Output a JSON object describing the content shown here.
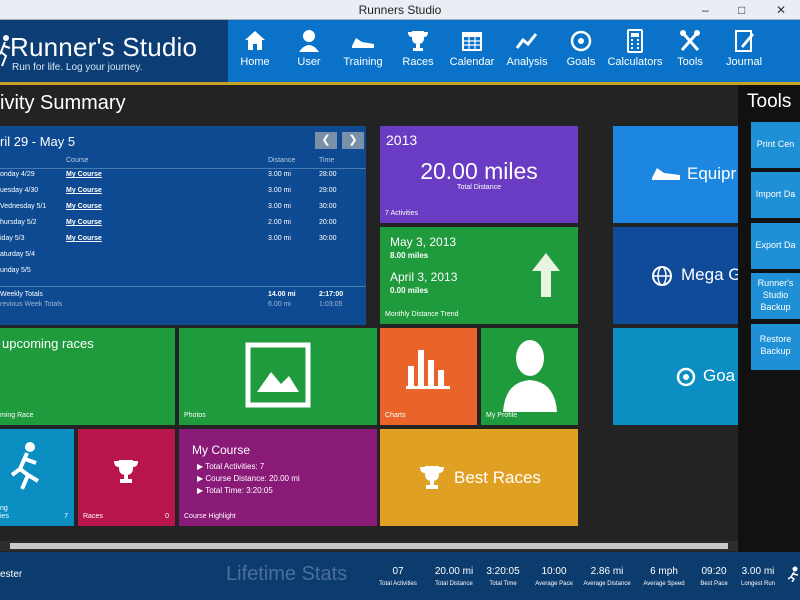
{
  "window": {
    "title": "Runners Studio"
  },
  "brand": {
    "title": "Runner's Studio",
    "tagline": "Run for life. Log your journey."
  },
  "nav": [
    "Home",
    "User",
    "Training",
    "Races",
    "Calendar",
    "Analysis",
    "Goals",
    "Calculators",
    "Tools",
    "Journal"
  ],
  "page": {
    "title": "ivity Summary"
  },
  "week": {
    "range": "ril 29 - May 5",
    "headers": {
      "course": "Course",
      "distance": "Distance",
      "time": "Time"
    },
    "rows": [
      {
        "day": "onday 4/29",
        "course": "My Course",
        "distance": "3.00 mi",
        "time": "28:00"
      },
      {
        "day": "uesday 4/30",
        "course": "My Course",
        "distance": "3.00 mi",
        "time": "29:00"
      },
      {
        "day": "Vednesday 5/1",
        "course": "My Course",
        "distance": "3.00 mi",
        "time": "30:00"
      },
      {
        "day": "hursday 5/2",
        "course": "My Course",
        "distance": "2.00 mi",
        "time": "20:00"
      },
      {
        "day": "iday 5/3",
        "course": "My Course",
        "distance": "3.00 mi",
        "time": "30:00"
      },
      {
        "day": "aturday 5/4",
        "course": "",
        "distance": "",
        "time": ""
      },
      {
        "day": "unday 5/5",
        "course": "",
        "distance": "",
        "time": ""
      }
    ],
    "totals": {
      "label": "Weekly Totals",
      "distance": "14.00 mi",
      "time": "2:17:00"
    },
    "previous": {
      "label": "revious Week Totals",
      "distance": "6.00 mi",
      "time": "1:03:05"
    }
  },
  "year": {
    "label": "2013",
    "distance": "20.00 miles",
    "caption": "Total Distance",
    "activities": "7 Activities"
  },
  "trend": {
    "d1": "May 3, 2013",
    "m1": "8.00 miles",
    "d2": "April 3, 2013",
    "m2": "0.00 miles",
    "label": "Monthly Distance Trend"
  },
  "tiles": {
    "equip": "Equipr",
    "mega": "Mega G",
    "goals": "Goa",
    "upcoming": "upcoming races",
    "upcomingLabel": "ming Race",
    "photos": "Photos",
    "charts": "Charts",
    "profile": "My Profile",
    "runsLabel": "ng",
    "runsLabel2": "ies",
    "runsCount": "7",
    "races": "Races",
    "racesCount": "0",
    "bestRaces": "Best Races"
  },
  "courseHighlight": {
    "title": "My Course",
    "activities": "Total Activities: 7",
    "distance": "Course Distance: 20.00 mi",
    "time": "Total Time: 3:20:05",
    "label": "Course Highlight"
  },
  "tools": {
    "title": "Tools",
    "buttons": [
      "Print Cen",
      "Import Da",
      "Export Da",
      "Runner's\nStudio\nBackup",
      "Restore\nBackup"
    ]
  },
  "lifetime": {
    "user": "ester",
    "title": "Lifetime Stats",
    "stats": [
      {
        "value": "07",
        "label": "Total Activities"
      },
      {
        "value": "20.00 mi",
        "label": "Total Distance"
      },
      {
        "value": "3:20:05",
        "label": "Total Time"
      },
      {
        "value": "10:00",
        "label": "Average Pace"
      },
      {
        "value": "2.86 mi",
        "label": "Average Distance"
      },
      {
        "value": "6 mph",
        "label": "Average Speed"
      },
      {
        "value": "09:20",
        "label": "Best Pace"
      },
      {
        "value": "3.00 mi",
        "label": "Longest Run"
      }
    ]
  }
}
